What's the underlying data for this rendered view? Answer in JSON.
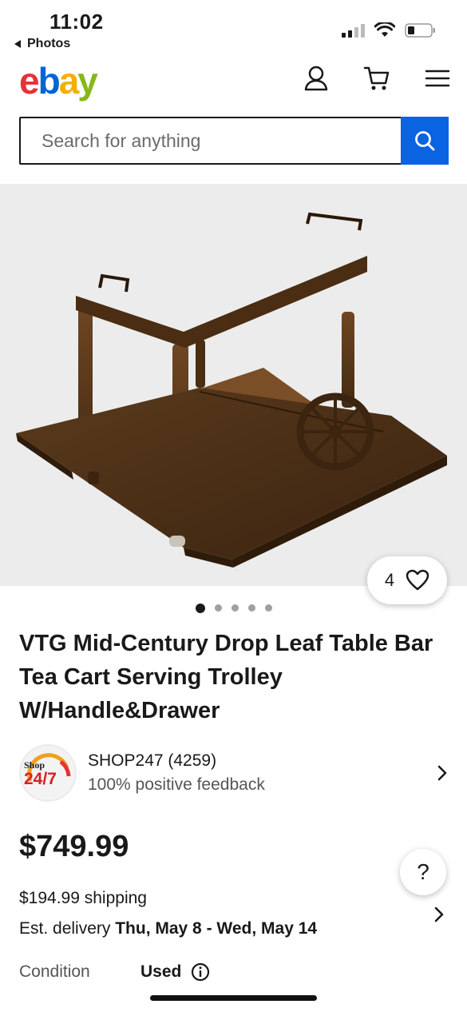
{
  "status_bar": {
    "time": "11:02",
    "back_label": "Photos",
    "icons": [
      "signal-icon",
      "wifi-icon",
      "battery-icon"
    ]
  },
  "header": {
    "logo": {
      "e": "e",
      "b": "b",
      "a": "a",
      "y": "y"
    },
    "icons": [
      "account-icon",
      "cart-icon",
      "menu-icon"
    ]
  },
  "search": {
    "placeholder": "Search for anything",
    "icon": "search-icon"
  },
  "gallery": {
    "image_count": 5,
    "active_index": 0,
    "watch_count": "4",
    "watch_icon": "heart-icon"
  },
  "item": {
    "title": "VTG Mid-Century Drop Leaf Table Bar Tea Cart Serving Trolley W/Handle&Drawer",
    "price": "$749.99",
    "shipping": "$194.99 shipping",
    "delivery_prefix": "Est. delivery",
    "delivery_dates": "Thu, May 8 - Wed, May 14",
    "condition_label": "Condition",
    "condition_value": "Used"
  },
  "seller": {
    "name": "SHOP247 (4259)",
    "feedback": "100% positive feedback",
    "logo_text_top": "Shop",
    "logo_text_bottom": "24/7"
  },
  "help": {
    "label": "?"
  },
  "colors": {
    "ebay_red": "#e53238",
    "ebay_blue": "#0064d2",
    "ebay_yellow": "#f5af02",
    "ebay_green": "#86b817",
    "search_button": "#0a63e0"
  }
}
